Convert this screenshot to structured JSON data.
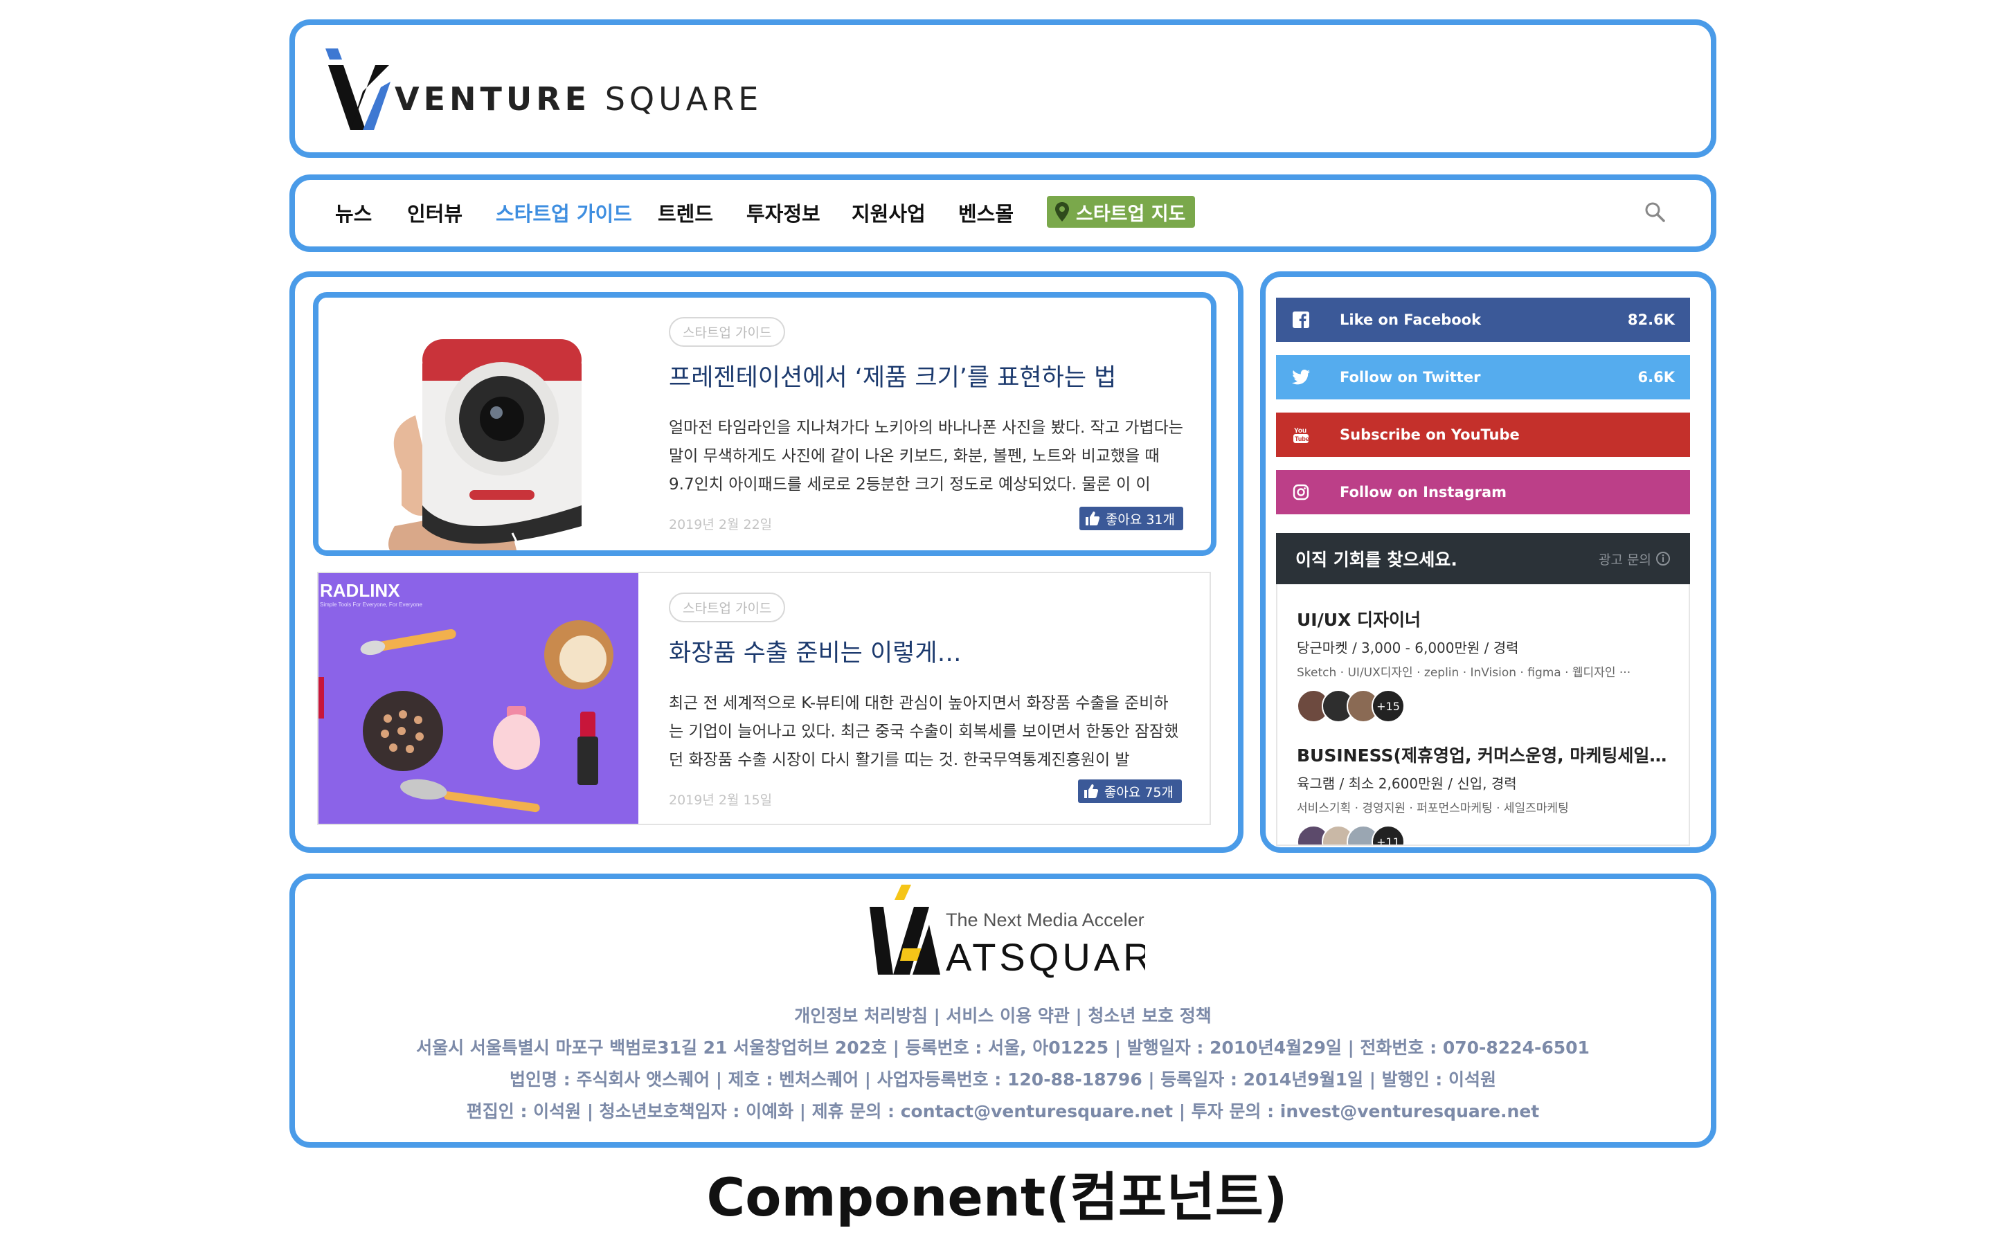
{
  "header": {
    "logo_text_bold": "VENTURE",
    "logo_text_light": "SQUARE"
  },
  "nav": {
    "items": [
      "뉴스",
      "인터뷰",
      "스타트업 가이드",
      "트렌드",
      "투자정보",
      "지원사업",
      "벤스몰"
    ],
    "active_index": 2,
    "map_label": "스타트업 지도",
    "search_icon": "search-icon",
    "colors": {
      "active": "#3e8ee0",
      "map_tag": "#7aa84b"
    }
  },
  "articles": [
    {
      "tag": "스타트업 가이드",
      "title": "프레젠테이션에서 ‘제품 크기’를 표현하는 법",
      "excerpt": "얼마전 타임라인을 지나쳐가다 노키아의 바나나폰 사진을 봤다. 작고 가볍다는 말이 무색하게도 사진에 같이 나온 키보드, 화분, 볼펜, 노트와 비교했을 때 9.7인치 아이패드를 세로로 2등분한 크기 정도로 예상되었다. 물론 이 이",
      "date": "2019년 2월 22일",
      "likes": "좋아요 31개"
    },
    {
      "tag": "스타트업 가이드",
      "title": "화장품 수출 준비는 이렇게…",
      "excerpt": "최근 전 세계적으로 K-뷰티에 대한 관심이 높아지면서 화장품 수출을 준비하는 기업이 늘어나고 있다. 최근 중국 수출이 회복세를 보이면서 한동안 잠잠했던 화장품 수출 시장이 다시 활기를 띠는 것. 한국무역통계진흥원이 발",
      "date": "2019년 2월 15일",
      "likes": "좋아요 75개",
      "thumb_brand": "RADLINX",
      "thumb_tagline": "Simple Tools For Everyone, For Everyone"
    }
  ],
  "social": [
    {
      "label": "Like on Facebook",
      "count": "82.6K",
      "color": "#3b5998",
      "icon": "facebook-icon"
    },
    {
      "label": "Follow on Twitter",
      "count": "6.6K",
      "color": "#55acee",
      "icon": "twitter-icon"
    },
    {
      "label": "Subscribe on YouTube",
      "count": "",
      "color": "#c4302b",
      "icon": "youtube-icon"
    },
    {
      "label": "Follow on Instagram",
      "count": "",
      "color": "#bc3f88",
      "icon": "instagram-icon"
    }
  ],
  "jobs": {
    "title": "이직 기회를 찾으세요.",
    "ad_label": "광고 문의",
    "items": [
      {
        "title": "UI/UX 디자이너",
        "meta": "당근마켓 / 3,000 - 6,000만원 / 경력",
        "tags": "Sketch · UI/UX디자인 · zeplin · InVision · figma · 웹디자인 ···",
        "more": "+15"
      },
      {
        "title": "BUSINESS(제휴영업, 커머스운영, 마케팅세일즈, …",
        "meta": "육그램 / 최소 2,600만원 / 신입, 경력",
        "tags": "서비스기획 · 경영지원 · 퍼포먼스마케팅 · 세일즈마케팅",
        "more": "+11"
      }
    ]
  },
  "footer": {
    "logo_tagline": "The Next Media Accelerator",
    "logo_text": "ATSQUARE",
    "lines": [
      "개인정보 처리방침 | 서비스 이용 약관 | 청소년 보호 정책",
      "서울시 서울특별시 마포구 백범로31길 21 서울창업허브 202호 | 등록번호 : 서울, 아01225 | 발행일자 : 2010년4월29일 | 전화번호 : 070-8224-6501",
      "법인명 : 주식회사 앳스퀘어 | 제호 : 벤처스퀘어 | 사업자등록번호 : 120-88-18796 | 등록일자 : 2014년9월1일 | 발행인 : 이석원",
      "편집인 : 이석원 | 청소년보호책임자 : 이예화 | 제휴 문의 : contact@venturesquare.net | 투자 문의 : invest@venturesquare.net"
    ]
  },
  "caption": "Component(컴포넌트)",
  "colors": {
    "outline": "#4a9be8",
    "footer_text": "#7c8aa8",
    "article_title": "#1c3a6e"
  }
}
